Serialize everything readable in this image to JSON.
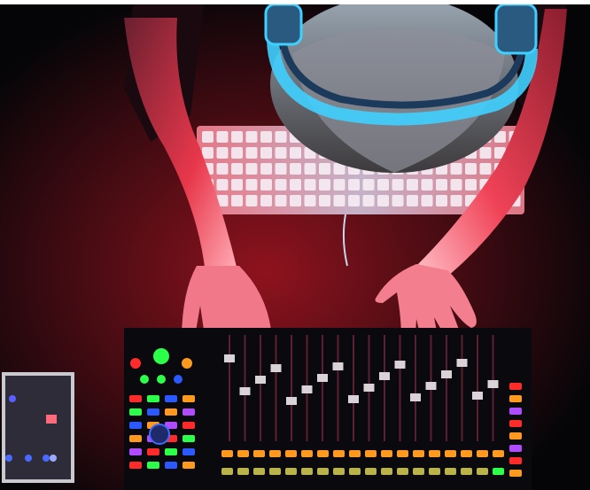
{
  "scene": {
    "subject": "overhead-photo",
    "palette": {
      "background": "#050508",
      "red_light": "#ff2a3a",
      "cyan_light": "#3fd0ff",
      "led_red": "#ff2b2b",
      "led_green": "#2bff4a",
      "led_blue": "#2b59ff",
      "led_orange": "#ff9a1f",
      "led_purple": "#b04bff"
    },
    "objects": [
      "headphones",
      "keyboard",
      "hands",
      "mixing-console",
      "audio-interface"
    ]
  }
}
